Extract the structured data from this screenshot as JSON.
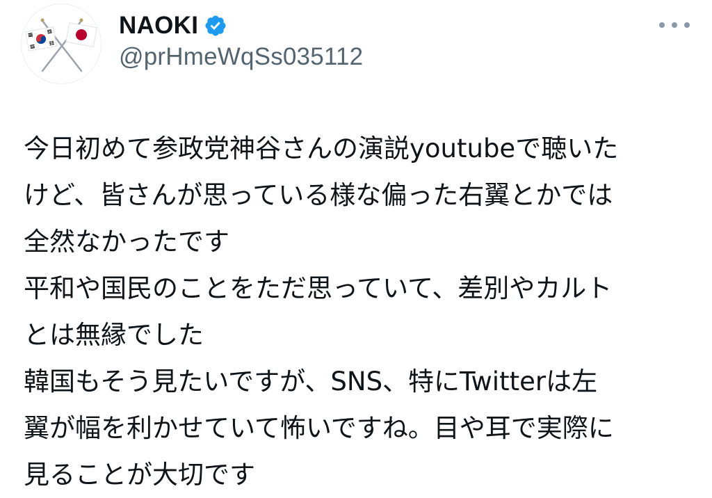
{
  "author": {
    "display_name": "NAOKI",
    "handle": "@prHmeWqSs035112",
    "verified": true,
    "avatar_icon": "crossed-flags-korea-japan-icon",
    "verified_icon": "verified-badge-icon",
    "verified_color": "#1d9bf0"
  },
  "menu": {
    "icon": "more-options-icon"
  },
  "tweet": {
    "lines": [
      "今日初めて参政党神谷さんの演説youtubeで聴いた",
      "けど、皆さんが思っている様な偏った右翼とかでは",
      "全然なかったです",
      "平和や国民のことをただ思っていて、差別やカルト",
      "とは無縁でした",
      "韓国もそう見たいですが、SNS、特にTwitterは左",
      "翼が幅を利かせていて怖いですね。目や耳で実際に",
      "見ることが大切です"
    ]
  },
  "colors": {
    "text": "#0f1419",
    "secondary": "#536471",
    "background": "#ffffff"
  }
}
